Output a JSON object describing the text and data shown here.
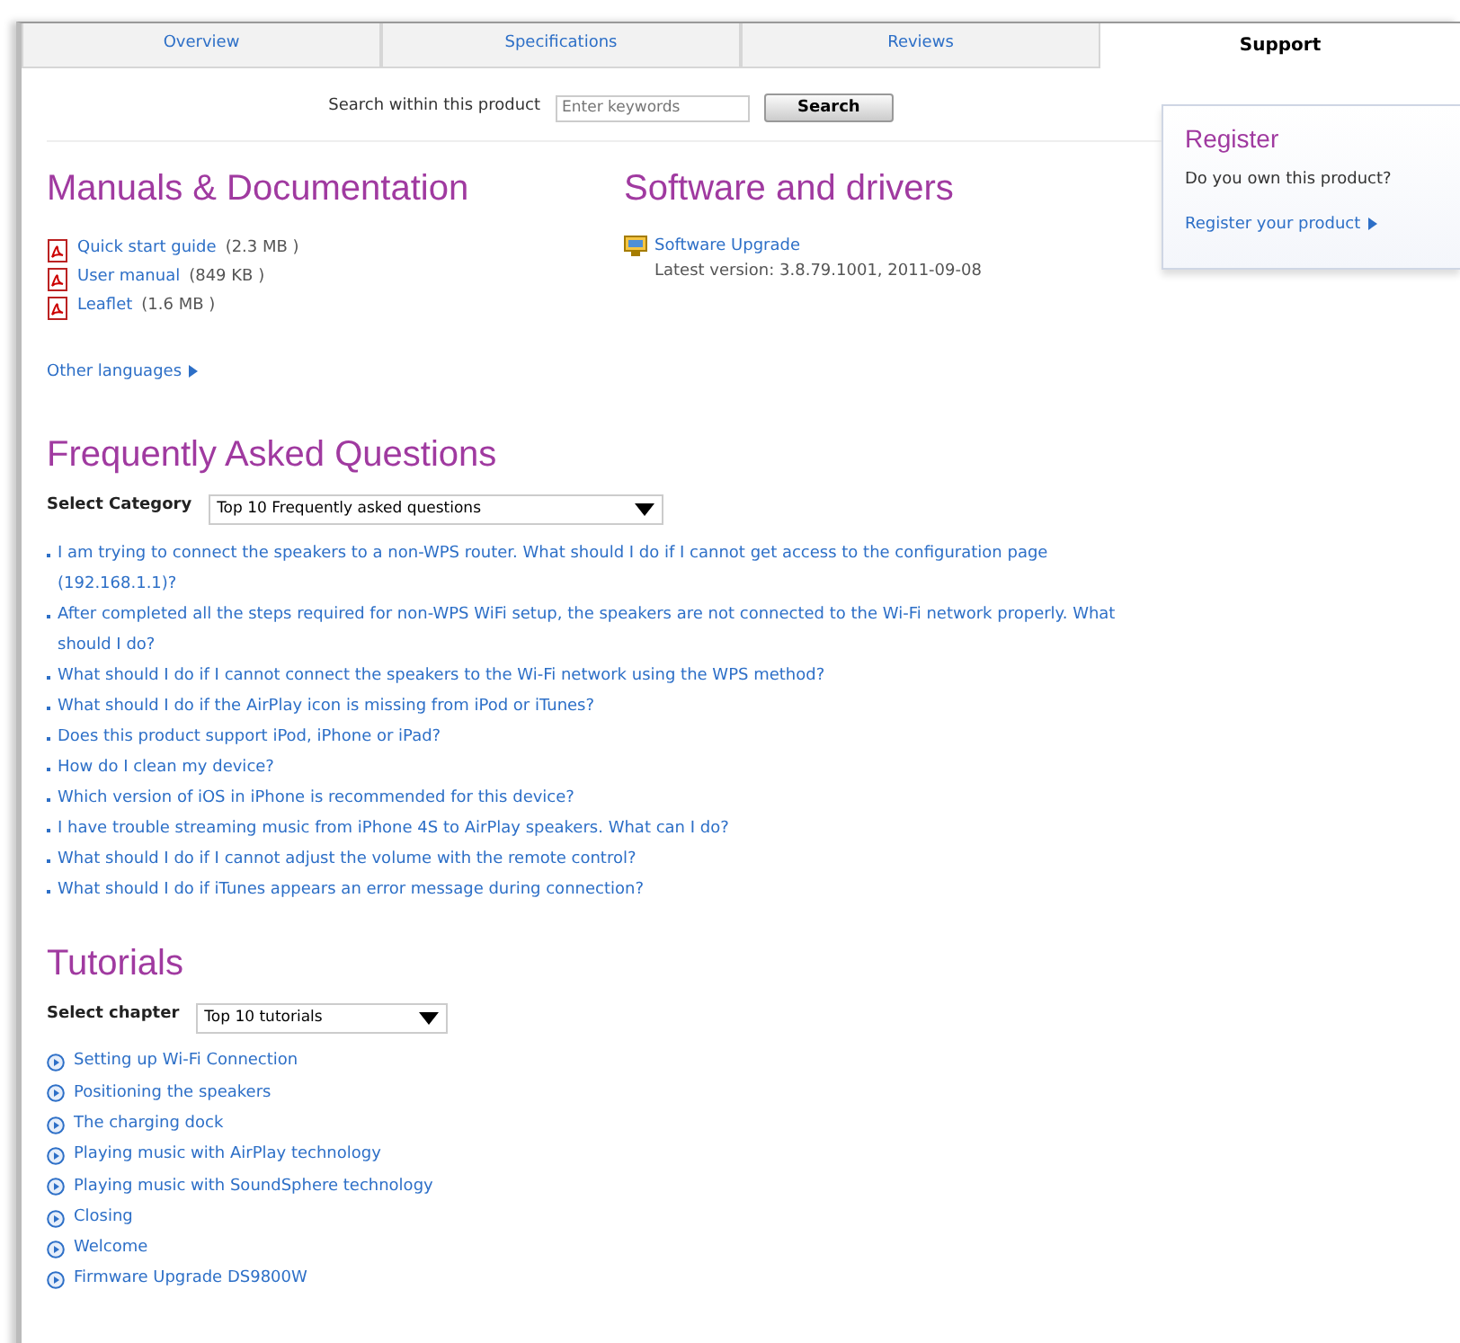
{
  "tabs": [
    {
      "label": "Overview",
      "selected": false
    },
    {
      "label": "Specifications",
      "selected": false
    },
    {
      "label": "Reviews",
      "selected": false
    },
    {
      "label": "Support",
      "selected": true
    }
  ],
  "search": {
    "label": "Search within this product",
    "placeholder": "Enter keywords",
    "button": "Search"
  },
  "manuals": {
    "title": "Manuals & Documentation",
    "items": [
      {
        "name": "Quick start guide",
        "size": "(2.3 MB )"
      },
      {
        "name": "User manual",
        "size": "(849 KB )"
      },
      {
        "name": "Leaflet",
        "size": "(1.6 MB )"
      }
    ],
    "more": "Other languages"
  },
  "software": {
    "title": "Software and drivers",
    "items": [
      {
        "name": "Software Upgrade",
        "detail": "Latest version: 3.8.79.1001, 2011-09-08"
      }
    ]
  },
  "register": {
    "title": "Register",
    "question": "Do you own this product?",
    "link": "Register your product"
  },
  "faq": {
    "title": "Frequently Asked Questions",
    "select_label": "Select Category",
    "select_value": "Top 10 Frequently asked questions",
    "questions": [
      "I am trying to connect the speakers to a non-WPS router. What should I do if I cannot get access to the configuration page (192.168.1.1)?",
      "After completed all the steps required for non-WPS WiFi setup, the speakers are not connected to the Wi-Fi network properly. What should I do?",
      "What should I do if I cannot connect the speakers to the Wi-Fi network using the WPS method?",
      "What should I do if the AirPlay icon is missing from iPod or iTunes?",
      "Does this product support iPod, iPhone or iPad?",
      "How do I clean my device?",
      "Which version of iOS in iPhone is recommended for this device?",
      "I have trouble streaming music from iPhone 4S to AirPlay speakers. What can I do?",
      "What should I do if I cannot adjust the volume with the remote control?",
      "What should I do if iTunes appears an error message during connection?"
    ]
  },
  "tutorials": {
    "title": "Tutorials",
    "select_label": "Select chapter",
    "select_value": "Top 10 tutorials",
    "items": [
      "Setting up Wi-Fi Connection",
      "Positioning the speakers",
      "The charging dock",
      "Playing music with AirPlay technology",
      "Playing music with SoundSphere technology",
      "Closing",
      "Welcome",
      "Firmware Upgrade DS9800W"
    ]
  }
}
